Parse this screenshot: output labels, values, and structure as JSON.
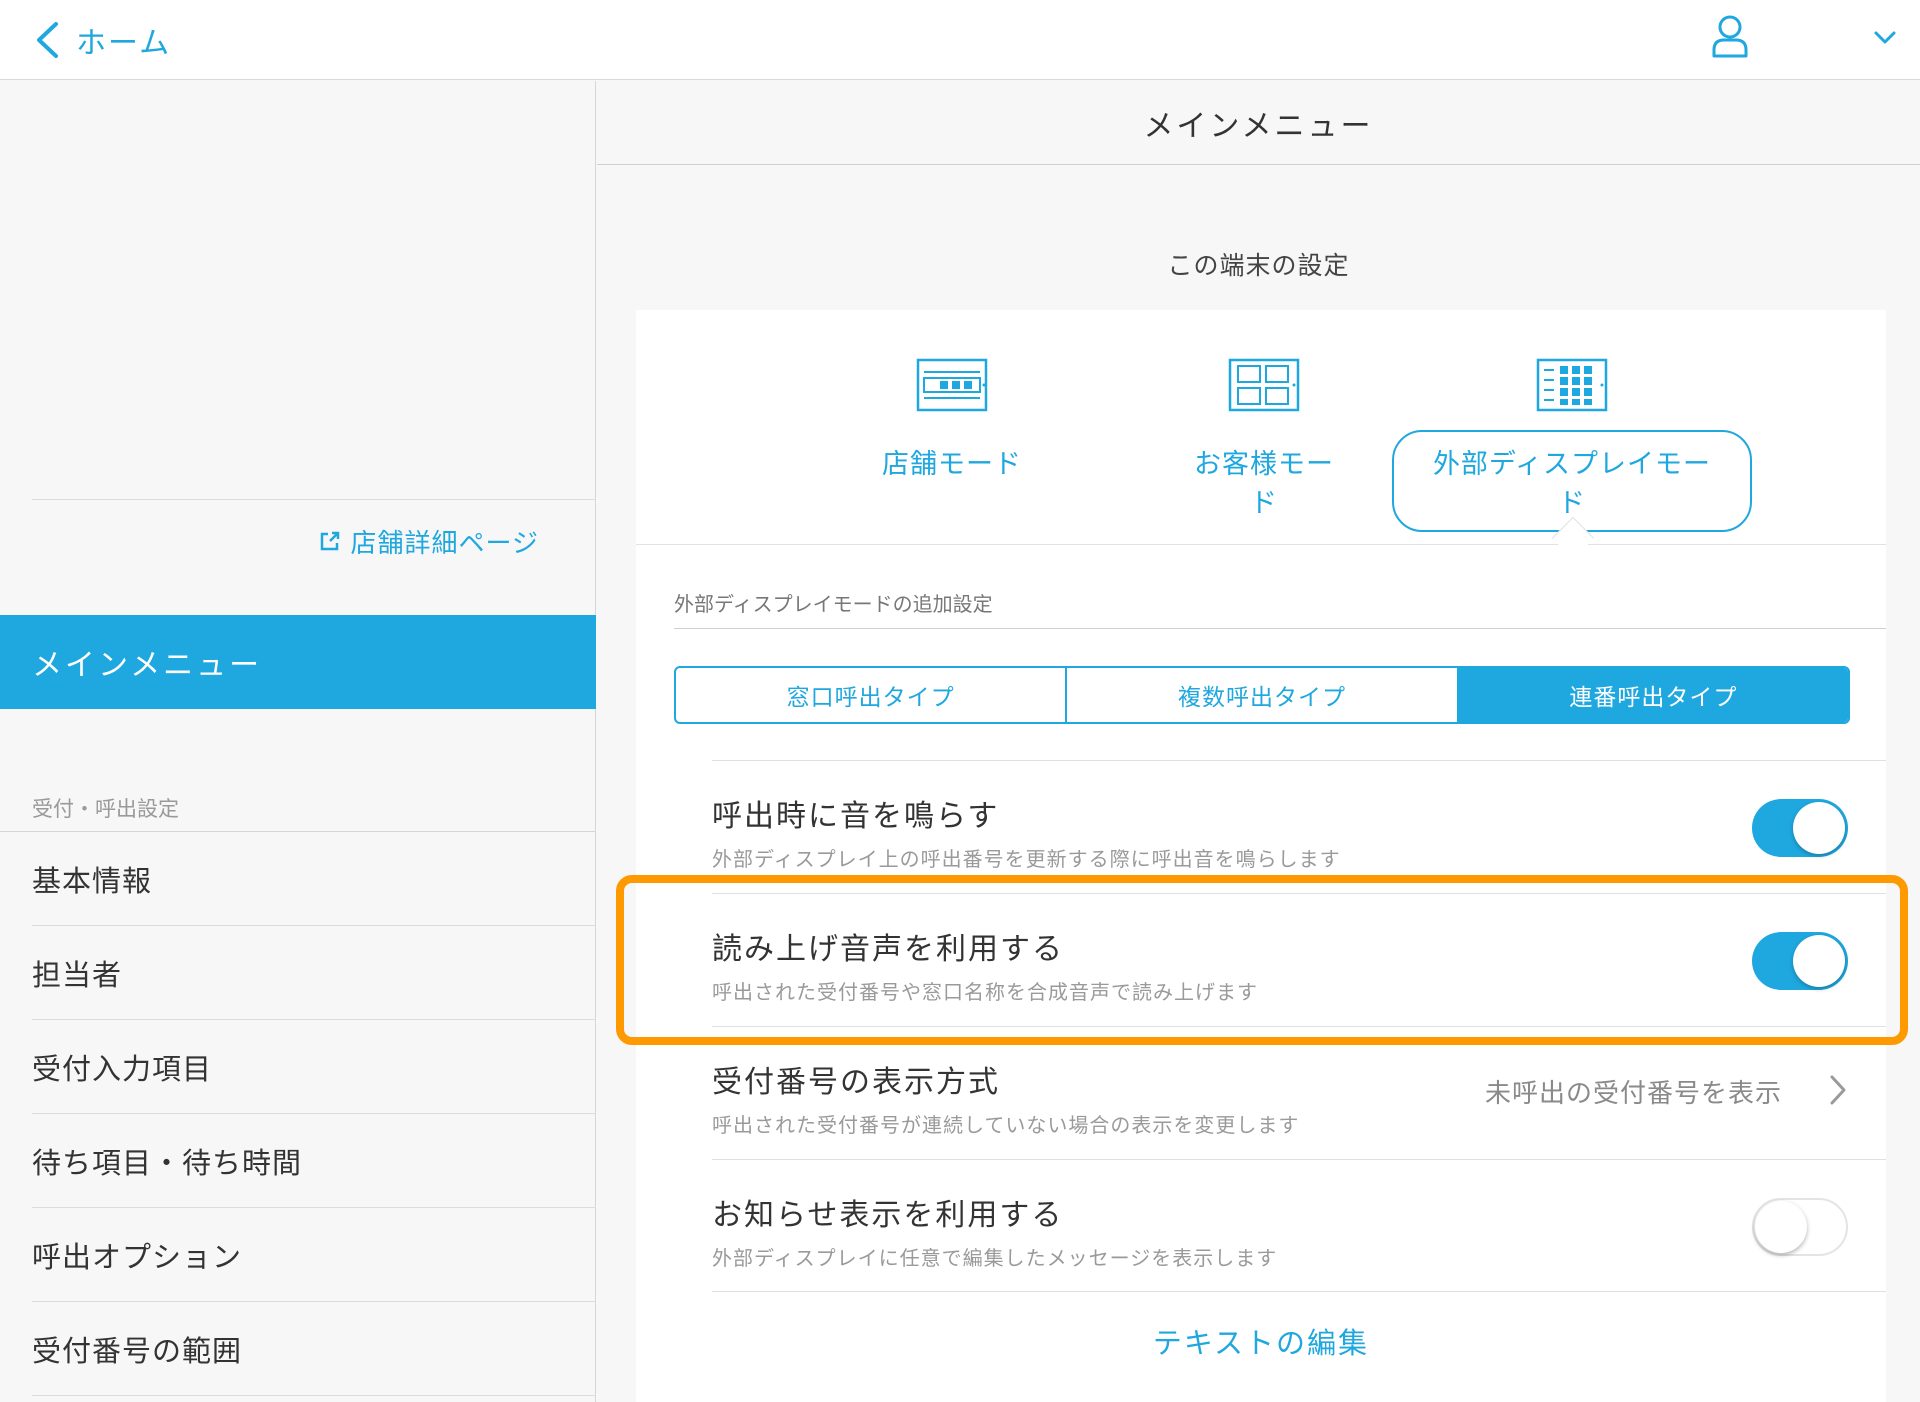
{
  "topbar": {
    "back_label": "ホーム",
    "icons": {
      "back": "chevron-left-icon",
      "user": "user-icon",
      "dropdown": "chevron-down-icon"
    }
  },
  "sidebar": {
    "store_link": "店舗詳細ページ",
    "main_menu": "メインメニュー",
    "section_label": "受付・呼出設定",
    "items": [
      {
        "label": "基本情報"
      },
      {
        "label": "担当者"
      },
      {
        "label": "受付入力項目"
      },
      {
        "label": "待ち項目・待ち時間"
      },
      {
        "label": "呼出オプション"
      },
      {
        "label": "受付番号の範囲"
      }
    ]
  },
  "main": {
    "header_title": "メインメニュー",
    "device_settings_title": "この端末の設定",
    "modes": [
      {
        "label": "店舗モード",
        "selected": false,
        "icon": "store-mode-icon"
      },
      {
        "label": "お客様モード",
        "selected": false,
        "icon": "customer-mode-icon"
      },
      {
        "label": "外部ディスプレイモード",
        "selected": true,
        "icon": "external-display-mode-icon"
      }
    ],
    "extra_settings_label": "外部ディスプレイモードの追加設定",
    "call_types": [
      {
        "label": "窓口呼出タイプ",
        "active": false
      },
      {
        "label": "複数呼出タイプ",
        "active": false
      },
      {
        "label": "連番呼出タイプ",
        "active": true
      }
    ],
    "settings": [
      {
        "title": "呼出時に音を鳴らす",
        "desc": "外部ディスプレイ上の呼出番号を更新する際に呼出音を鳴らします",
        "toggle": true
      },
      {
        "title": "読み上げ音声を利用する",
        "desc": "呼出された受付番号や窓口名称を合成音声で読み上げます",
        "toggle": true
      },
      {
        "title": "受付番号の表示方式",
        "desc": "呼出された受付番号が連続していない場合の表示を変更します",
        "value": "未呼出の受付番号を表示"
      },
      {
        "title": "お知らせ表示を利用する",
        "desc": "外部ディスプレイに任意で編集したメッセージを表示します",
        "toggle": false
      }
    ],
    "edit_text": "テキストの編集"
  },
  "colors": {
    "accent": "#1fa7df",
    "highlight": "#ff9900",
    "background": "#f7f7f7"
  }
}
